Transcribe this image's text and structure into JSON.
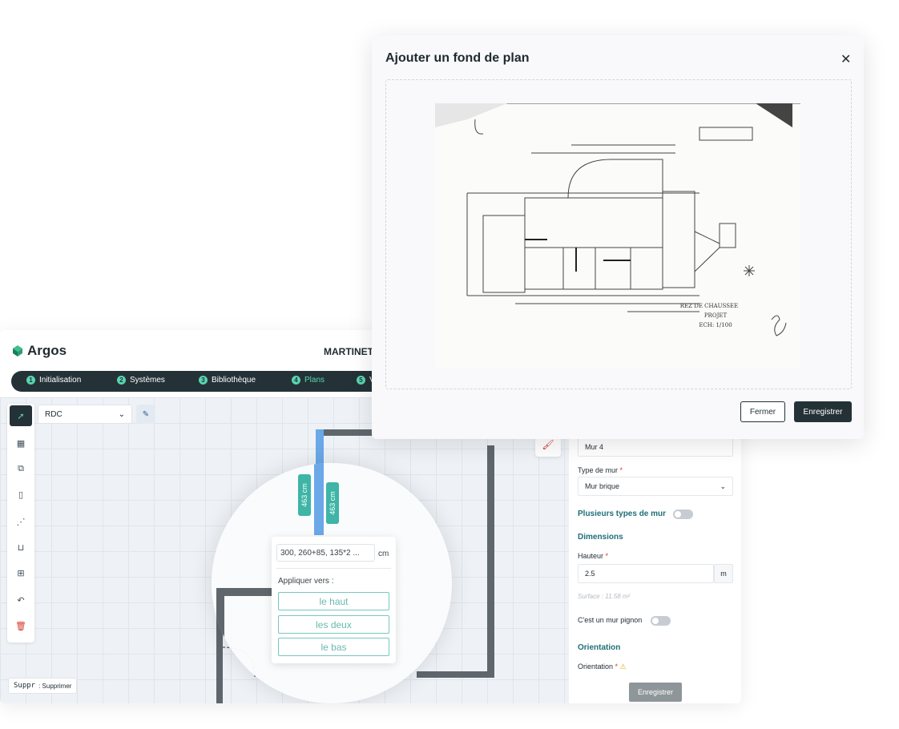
{
  "app": {
    "name": "Argos",
    "project": "MARTINET",
    "steps": [
      {
        "num": "1",
        "label": "Initialisation"
      },
      {
        "num": "2",
        "label": "Systèmes"
      },
      {
        "num": "3",
        "label": "Bibliothèque"
      },
      {
        "num": "4",
        "label": "Plans"
      },
      {
        "num": "5",
        "label": "V"
      }
    ],
    "level": "RDC",
    "shortcut": {
      "key": "Suppr",
      "desc": ": Supprimer"
    }
  },
  "wall_editor": {
    "dim_label": "463 cm",
    "input_value": "300, 260+85, 135*2 ...",
    "unit": "cm",
    "apply_label": "Appliquer vers :",
    "apply_options": [
      "le haut",
      "les deux",
      "le bas"
    ]
  },
  "panel": {
    "wall_name": "Mur 4",
    "wall_type_label": "Type de mur",
    "wall_type_value": "Mur brique",
    "multi_types_label": "Plusieurs types de mur",
    "dimensions_title": "Dimensions",
    "height_label": "Hauteur",
    "height_value": "2.5",
    "height_unit": "m",
    "surface": "Surface : 11.58 m²",
    "gable_label": "C'est un mur pignon",
    "orientation_title": "Orientation",
    "orientation_label": "Orientation",
    "save_label": "Enregistrer"
  },
  "modal": {
    "title": "Ajouter un fond de plan",
    "close_label": "Fermer",
    "save_label": "Enregistrer",
    "plan_caption": [
      "REZ DE CHAUSSEE",
      "PROJET",
      "ECH: 1/100"
    ]
  },
  "colors": {
    "dark": "#243238",
    "accent": "#5ad4b0",
    "teal": "#3eb5a6",
    "danger": "#d53b2e"
  }
}
